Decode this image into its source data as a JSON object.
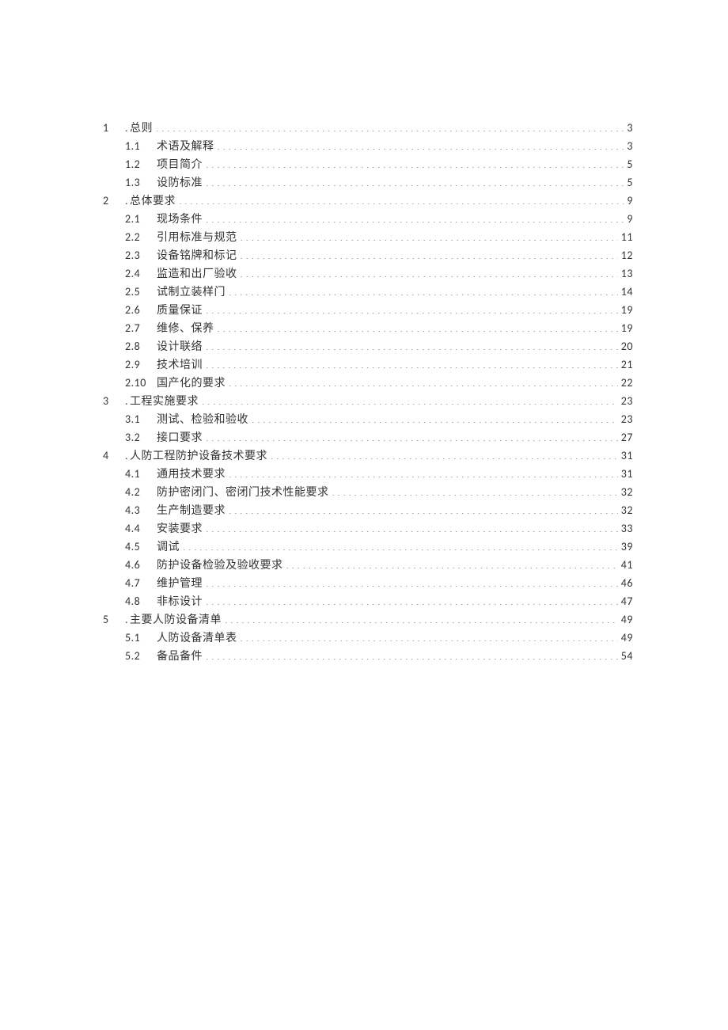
{
  "toc": [
    {
      "level": 1,
      "num": "1",
      "prefix": ".",
      "title": "总则",
      "page": "3"
    },
    {
      "level": 2,
      "num": "1.1",
      "prefix": "",
      "title": "术语及解释",
      "page": "3"
    },
    {
      "level": 2,
      "num": "1.2",
      "prefix": "",
      "title": "项目简介",
      "page": "5"
    },
    {
      "level": 2,
      "num": "1.3",
      "prefix": "",
      "title": "设防标准",
      "page": "5"
    },
    {
      "level": 1,
      "num": "2",
      "prefix": ".",
      "title": "总体要求",
      "page": "9"
    },
    {
      "level": 2,
      "num": "2.1",
      "prefix": "",
      "title": "现场条件",
      "page": "9"
    },
    {
      "level": 2,
      "num": "2.2",
      "prefix": "",
      "title": "引用标准与规范",
      "page": "11"
    },
    {
      "level": 2,
      "num": "2.3",
      "prefix": "",
      "title": "设备铭牌和标记",
      "page": "12"
    },
    {
      "level": 2,
      "num": "2.4",
      "prefix": "",
      "title": "监造和出厂验收",
      "page": "13"
    },
    {
      "level": 2,
      "num": "2.5",
      "prefix": "",
      "title": "试制立装样门",
      "page": "14"
    },
    {
      "level": 2,
      "num": "2.6",
      "prefix": "",
      "title": "质量保证",
      "page": "19"
    },
    {
      "level": 2,
      "num": "2.7",
      "prefix": "",
      "title": "维修、保养",
      "page": "19"
    },
    {
      "level": 2,
      "num": "2.8",
      "prefix": "",
      "title": "设计联络",
      "page": "20"
    },
    {
      "level": 2,
      "num": "2.9",
      "prefix": "",
      "title": "技术培训",
      "page": "21"
    },
    {
      "level": 2,
      "num": "2.10",
      "prefix": "",
      "title": "国产化的要求",
      "page": "22"
    },
    {
      "level": 1,
      "num": "3",
      "prefix": ".",
      "title": "工程实施要求",
      "page": "23"
    },
    {
      "level": 2,
      "num": "3.1",
      "prefix": "",
      "title": "测试、检验和验收",
      "page": "23"
    },
    {
      "level": 2,
      "num": "3.2",
      "prefix": "",
      "title": "接口要求",
      "page": "27"
    },
    {
      "level": 1,
      "num": "4",
      "prefix": ".",
      "title": "人防工程防护设备技术要求",
      "page": "31"
    },
    {
      "level": 2,
      "num": "4.1",
      "prefix": "",
      "title": "通用技术要求",
      "page": "31"
    },
    {
      "level": 2,
      "num": "4.2",
      "prefix": "",
      "title": "防护密闭门、密闭门技术性能要求",
      "page": "32"
    },
    {
      "level": 2,
      "num": "4.3",
      "prefix": "",
      "title": "生产制造要求",
      "page": "32"
    },
    {
      "level": 2,
      "num": "4.4",
      "prefix": "",
      "title": "安装要求",
      "page": "33"
    },
    {
      "level": 2,
      "num": "4.5",
      "prefix": "",
      "title": "调试",
      "page": "39"
    },
    {
      "level": 2,
      "num": "4.6",
      "prefix": "",
      "title": "防护设备检验及验收要求",
      "page": "41"
    },
    {
      "level": 2,
      "num": "4.7",
      "prefix": "",
      "title": "维护管理",
      "page": "46"
    },
    {
      "level": 2,
      "num": "4.8",
      "prefix": "",
      "title": "非标设计",
      "page": "47"
    },
    {
      "level": 1,
      "num": "5",
      "prefix": ".",
      "title": "主要人防设备清单",
      "page": "49"
    },
    {
      "level": 2,
      "num": "5.1",
      "prefix": "",
      "title": "人防设备清单表",
      "page": "49"
    },
    {
      "level": 2,
      "num": "5.2",
      "prefix": "",
      "title": "备品备件",
      "page": "54"
    }
  ]
}
